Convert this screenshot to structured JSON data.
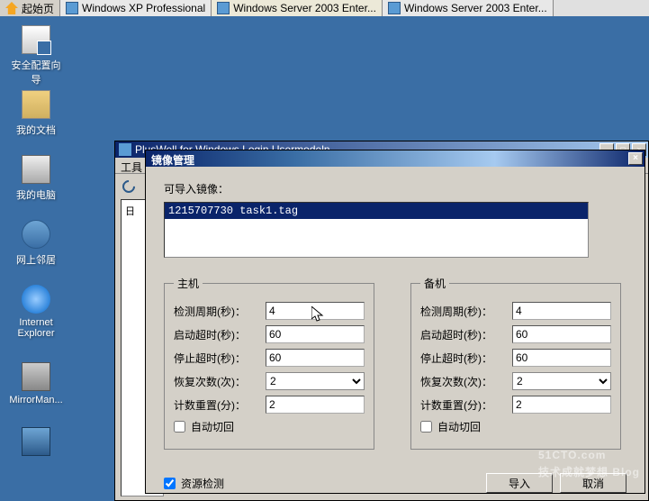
{
  "taskbar": {
    "home": "起始页",
    "tabs": [
      "Windows XP Professional",
      "Windows Server 2003 Enter...",
      "Windows Server 2003 Enter..."
    ]
  },
  "desktop": [
    {
      "label": "安全配置向导"
    },
    {
      "label": "我的文档"
    },
    {
      "label": "我的电脑"
    },
    {
      "label": "网上邻居"
    },
    {
      "label": "Internet Explorer"
    },
    {
      "label": "MirrorMan..."
    },
    {
      "label": ""
    }
  ],
  "bg_window": {
    "title": "PlusWell for Windows Login Usermodeln",
    "menu": "工具",
    "tree": "日"
  },
  "dialog": {
    "title": "镜像管理",
    "import_label": "可导入镜像：",
    "list_item": "1215707730   task1.tag",
    "groups": {
      "primary": {
        "legend": "主机",
        "detect_label": "检测周期(秒)：",
        "detect_val": "4",
        "start_label": "启动超时(秒)：",
        "start_val": "60",
        "stop_label": "停止超时(秒)：",
        "stop_val": "60",
        "recover_label": "恢复次数(次)：",
        "recover_val": "2",
        "reset_label": "计数重置(分)：",
        "reset_val": "2",
        "autoswitch": "自动切回"
      },
      "backup": {
        "legend": "备机",
        "detect_label": "检测周期(秒)：",
        "detect_val": "4",
        "start_label": "启动超时(秒)：",
        "start_val": "60",
        "stop_label": "停止超时(秒)：",
        "stop_val": "60",
        "recover_label": "恢复次数(次)：",
        "recover_val": "2",
        "reset_label": "计数重置(分)：",
        "reset_val": "2",
        "autoswitch": "自动切回"
      }
    },
    "resource_check": "资源检测",
    "import_btn": "导入",
    "cancel_btn": "取消"
  },
  "watermark": {
    "main": "51CTO.com",
    "sub": "技术成就梦想  Blog"
  }
}
